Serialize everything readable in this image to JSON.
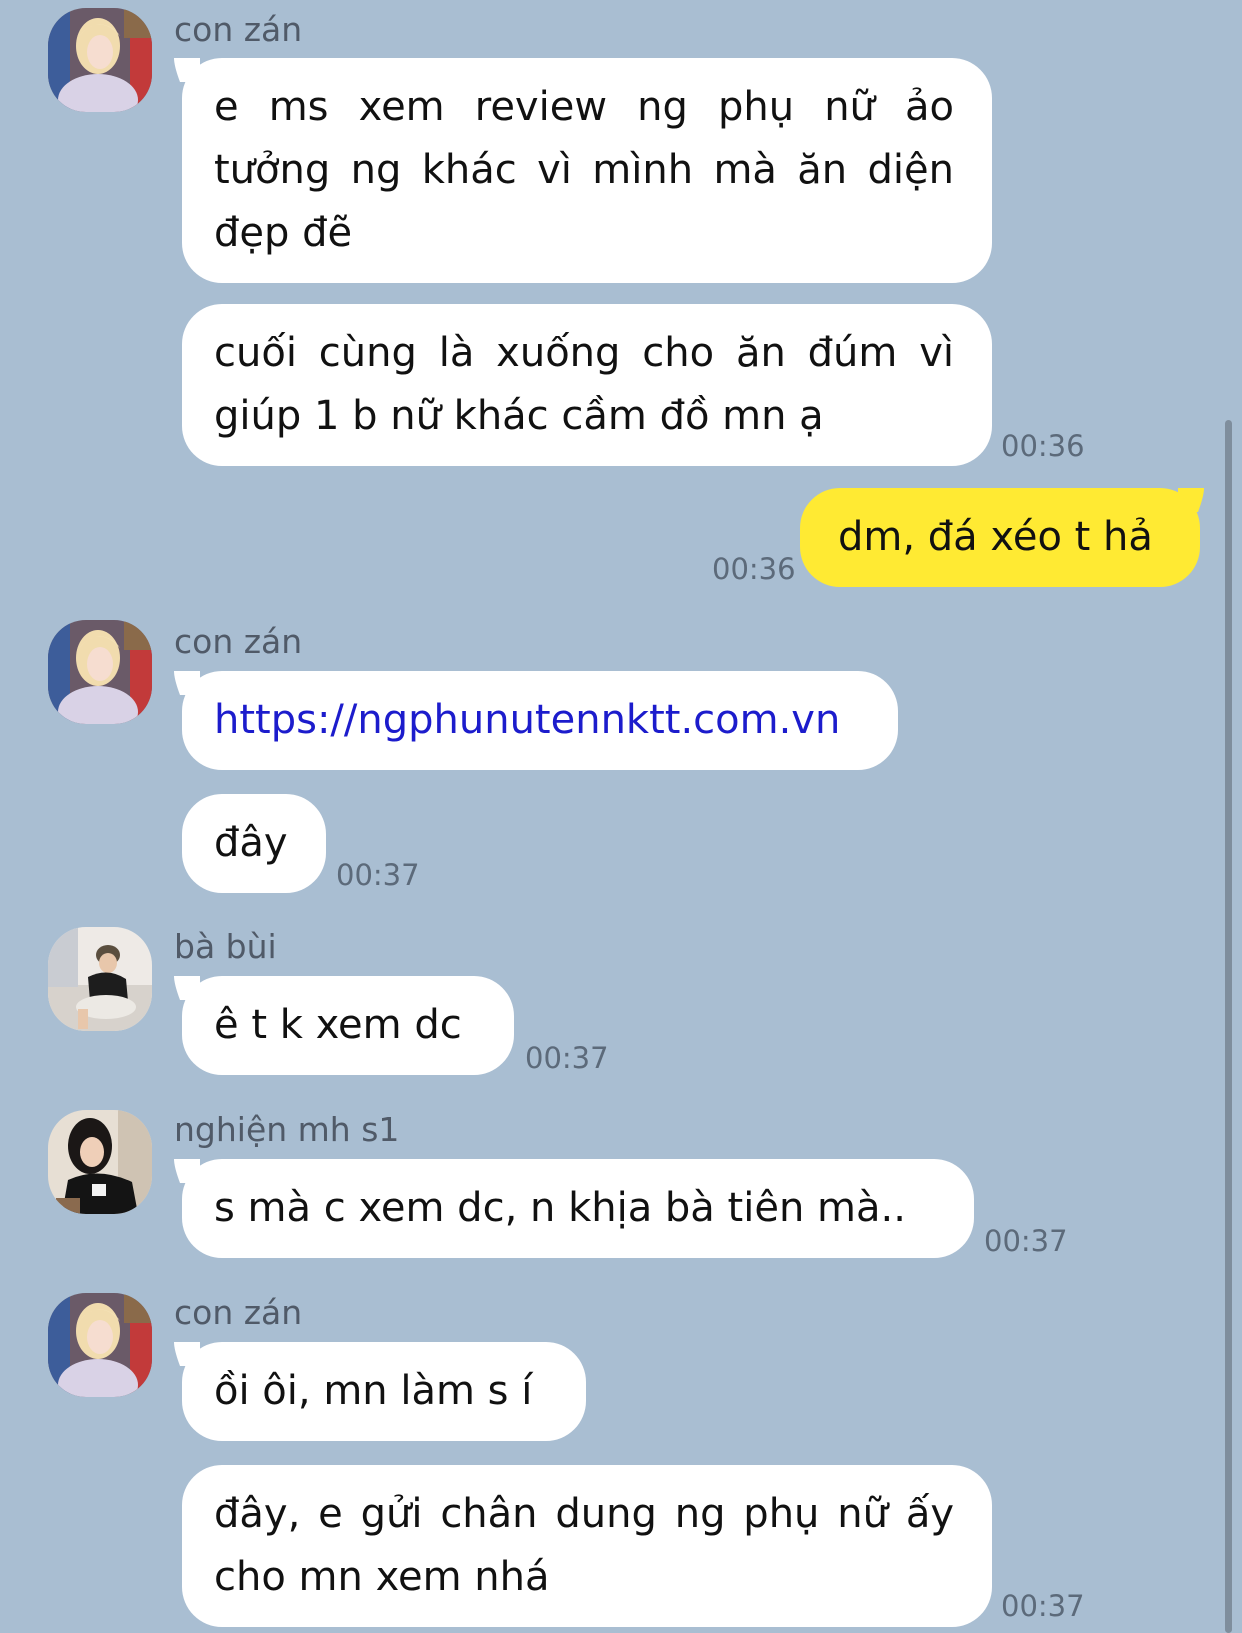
{
  "colors": {
    "background": "#a9bed2",
    "incoming_bubble": "#ffffff",
    "outgoing_bubble": "#ffea33",
    "link": "#1c1ccc"
  },
  "messages": [
    {
      "sender": "con zán",
      "avatar": "avatar-con-zan",
      "bubbles": [
        "e ms xem review ng phụ nữ ảo tưởng ng khác vì mình mà ăn diện đẹp đẽ",
        "cuối cùng là xuống cho ăn đúm vì giúp 1 b nữ khác cầm đồ mn ạ"
      ],
      "time": "00:36"
    },
    {
      "outgoing": true,
      "text": "dm, đá xéo t hả",
      "time": "00:36"
    },
    {
      "sender": "con zán",
      "avatar": "avatar-con-zan",
      "link": "https://ngphunutennktt.com.vn",
      "text": "đây",
      "time": "00:37"
    },
    {
      "sender": "bà bùi",
      "avatar": "avatar-ba-bui",
      "text": "ê t k xem dc",
      "time": "00:37"
    },
    {
      "sender": "nghiện mh s1",
      "avatar": "avatar-nghien-mh",
      "text": "s mà c xem dc, n khịa bà tiên mà..",
      "time": "00:37"
    },
    {
      "sender": "con zán",
      "avatar": "avatar-con-zan",
      "bubbles": [
        "ồi ôi, mn làm s í",
        "đây, e gửi chân dung ng phụ nữ ấy cho mn xem nhá"
      ],
      "time": "00:37"
    }
  ]
}
